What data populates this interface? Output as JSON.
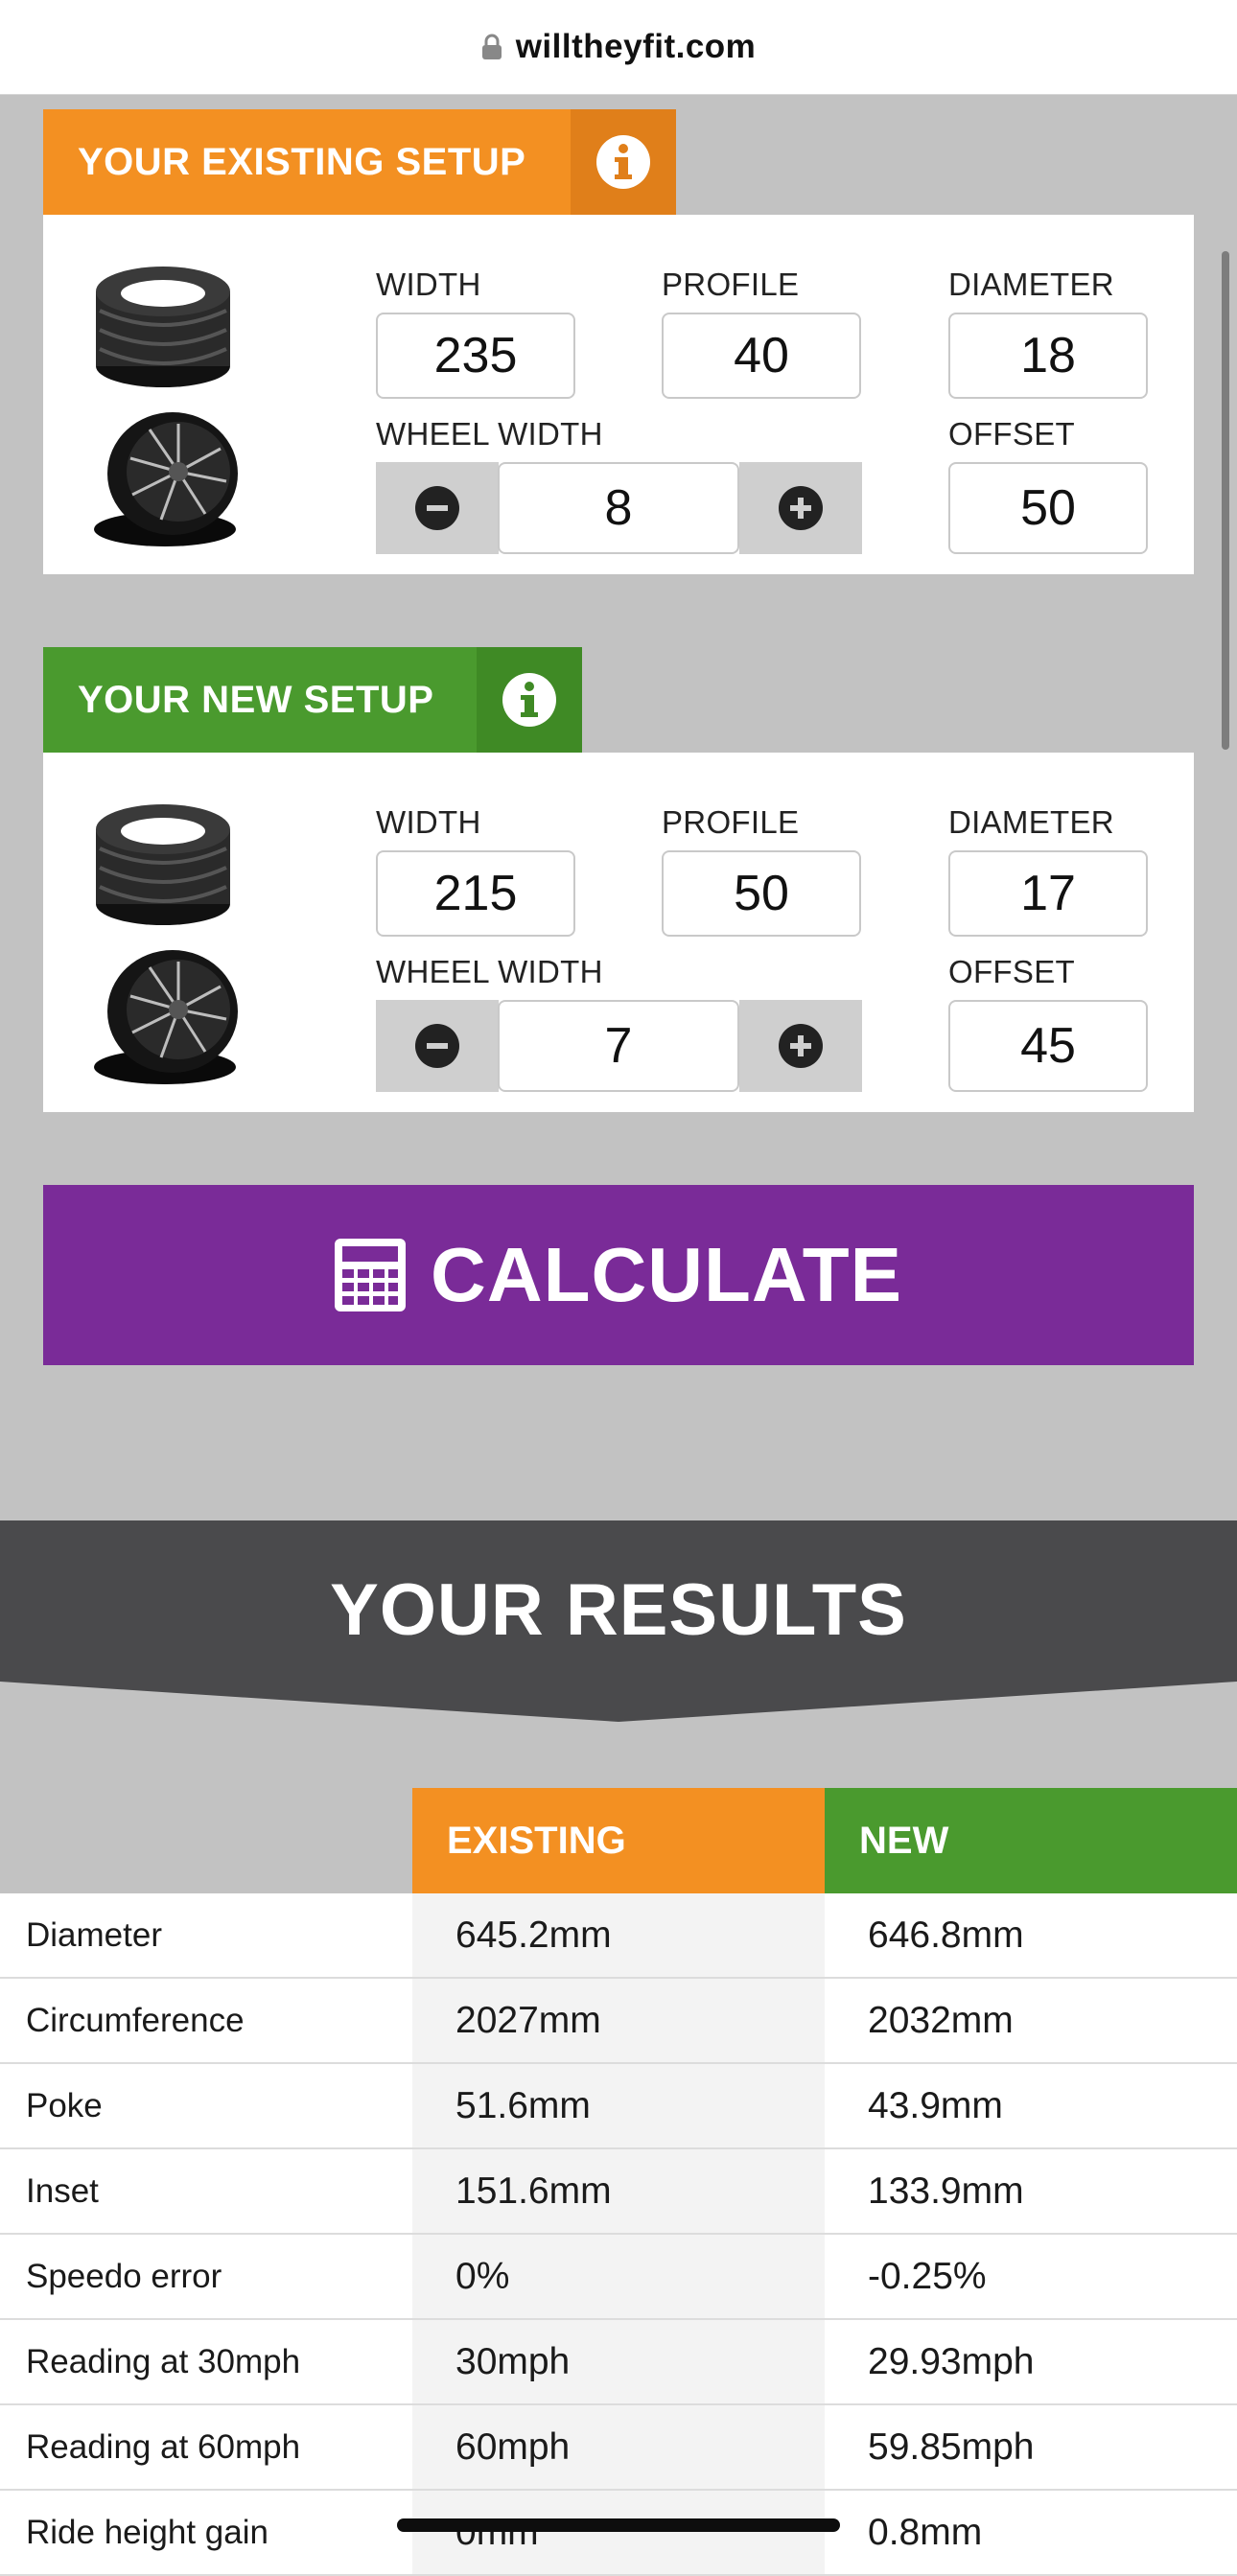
{
  "browser": {
    "url": "willtheyfit.com"
  },
  "existing_setup": {
    "title": "YOUR EXISTING SETUP",
    "labels": {
      "width": "WIDTH",
      "profile": "PROFILE",
      "diameter": "DIAMETER",
      "wheel_width": "WHEEL WIDTH",
      "offset": "OFFSET"
    },
    "values": {
      "width": "235",
      "profile": "40",
      "diameter": "18",
      "wheel_width": "8",
      "offset": "50"
    },
    "accent": "#f39022"
  },
  "new_setup": {
    "title": "YOUR NEW SETUP",
    "labels": {
      "width": "WIDTH",
      "profile": "PROFILE",
      "diameter": "DIAMETER",
      "wheel_width": "WHEEL WIDTH",
      "offset": "OFFSET"
    },
    "values": {
      "width": "215",
      "profile": "50",
      "diameter": "17",
      "wheel_width": "7",
      "offset": "45"
    },
    "accent": "#4a9a2e"
  },
  "calculate": {
    "label": "CALCULATE",
    "icon": "calculator-icon",
    "color": "#7a2b98"
  },
  "results": {
    "title": "YOUR RESULTS",
    "columns": {
      "existing": "EXISTING",
      "new": "NEW"
    },
    "rows": [
      {
        "label": "Diameter",
        "existing": "645.2mm",
        "new": "646.8mm"
      },
      {
        "label": "Circumference",
        "existing": "2027mm",
        "new": "2032mm"
      },
      {
        "label": "Poke",
        "existing": "51.6mm",
        "new": "43.9mm"
      },
      {
        "label": "Inset",
        "existing": "151.6mm",
        "new": "133.9mm"
      },
      {
        "label": "Speedo error",
        "existing": "0%",
        "new": "-0.25%"
      },
      {
        "label": "Reading at 30mph",
        "existing": "30mph",
        "new": "29.93mph"
      },
      {
        "label": "Reading at 60mph",
        "existing": "60mph",
        "new": "59.85mph"
      },
      {
        "label": "Ride height gain",
        "existing": "0mm",
        "new": "0.8mm"
      }
    ]
  },
  "icons": {
    "lock": "lock-icon",
    "info": "info-icon",
    "minus": "minus-circle-icon",
    "plus": "plus-circle-icon"
  }
}
